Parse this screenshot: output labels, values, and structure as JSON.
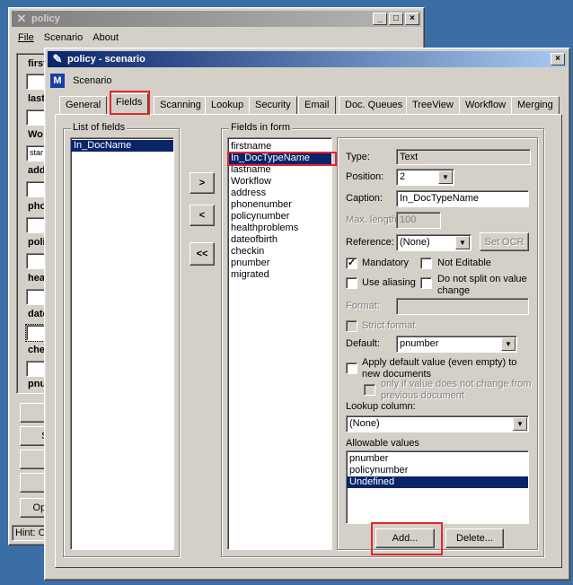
{
  "back_window": {
    "title": "policy",
    "menu": [
      "File",
      "Scenario",
      "About"
    ],
    "field_labels": [
      "first",
      "last",
      "Wo",
      "add",
      "pho",
      "poli",
      "hea",
      "date",
      "che",
      "pnu"
    ],
    "wo_value": "star",
    "buttons": [
      "S",
      "Sc",
      "O",
      "S",
      "Oper"
    ],
    "hint": "Hint: O"
  },
  "dialog": {
    "title": "policy - scenario",
    "toolbar_label": "Scenario",
    "tabs": [
      "General",
      "Fields",
      "Scanning",
      "Lookup",
      "Security",
      "Email",
      "Doc. Queues",
      "TreeView",
      "Workflow",
      "Merging"
    ],
    "selected_tab": "Fields",
    "list_of_fields": {
      "label": "List of fields",
      "items": [
        "In_DocName"
      ]
    },
    "move_buttons": [
      ">",
      "<",
      "<<"
    ],
    "fields_in_form": {
      "label": "Fields in form",
      "items": [
        "firstname",
        "In_DocTypeName",
        "lastname",
        "Workflow",
        "address",
        "phonenumber",
        "policynumber",
        "healthproblems",
        "dateofbirth",
        "checkin",
        "pnumber",
        "migrated"
      ],
      "selected": "In_DocTypeName"
    },
    "properties": {
      "type_label": "Type:",
      "type_value": "Text",
      "position_label": "Position:",
      "position_value": "2",
      "caption_label": "Caption:",
      "caption_value": "In_DocTypeName",
      "maxlength_label": "Max. length:",
      "maxlength_value": "100",
      "reference_label": "Reference:",
      "reference_value": "(None)",
      "setocr_label": "Set OCR",
      "mandatory_label": "Mandatory",
      "mandatory_checked": true,
      "not_editable_label": "Not Editable",
      "use_aliasing_label": "Use aliasing",
      "do_not_split_label": "Do not split on value change",
      "format_label": "Format:",
      "strict_format_label": "Strict format",
      "default_label": "Default:",
      "default_value": "pnumber",
      "apply_default_label": "Apply default value (even empty) to new documents",
      "only_if_label": "only if value does not change from previous document",
      "lookup_column_label": "Lookup column:",
      "lookup_column_value": "(None)",
      "allowable_values_label": "Allowable values",
      "allowable_values": [
        "pnumber",
        "policynumber",
        "Undefined"
      ],
      "allowable_selected": "Undefined",
      "add_label": "Add...",
      "delete_label": "Delete..."
    }
  },
  "colors": {
    "desktop": "#3a6ea5",
    "selection": "#0a246a",
    "highlight": "#e0282b",
    "face": "#d4d0c8"
  }
}
